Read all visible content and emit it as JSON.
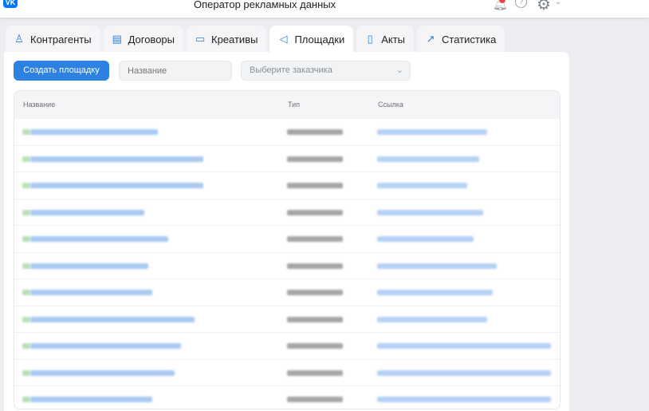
{
  "header": {
    "logo": "VK",
    "title": "Оператор рекламных данных",
    "icons": [
      "bell-icon",
      "help-icon",
      "gear-icon",
      "chevron-down-icon"
    ],
    "notification": true
  },
  "tabs": [
    {
      "label": "Контрагенты",
      "icon": "user-icon",
      "glyph": "♙"
    },
    {
      "label": "Договоры",
      "icon": "book-icon",
      "glyph": "▤"
    },
    {
      "label": "Креативы",
      "icon": "card-icon",
      "glyph": "▭"
    },
    {
      "label": "Площадки",
      "icon": "megaphone-icon",
      "glyph": "◁"
    },
    {
      "label": "Акты",
      "icon": "document-icon",
      "glyph": "▯"
    },
    {
      "label": "Статистика",
      "icon": "chart-icon",
      "glyph": "↗"
    }
  ],
  "active_tab": "Площадки",
  "toolbar": {
    "create_label": "Создать площадку",
    "name_placeholder": "Название",
    "customer_placeholder": "Выберите заказчика"
  },
  "table": {
    "columns": [
      "Название",
      "Тип",
      "Ссылка"
    ]
  },
  "colors": {
    "accent": "#2d81e0",
    "background": "#ebedf0"
  }
}
